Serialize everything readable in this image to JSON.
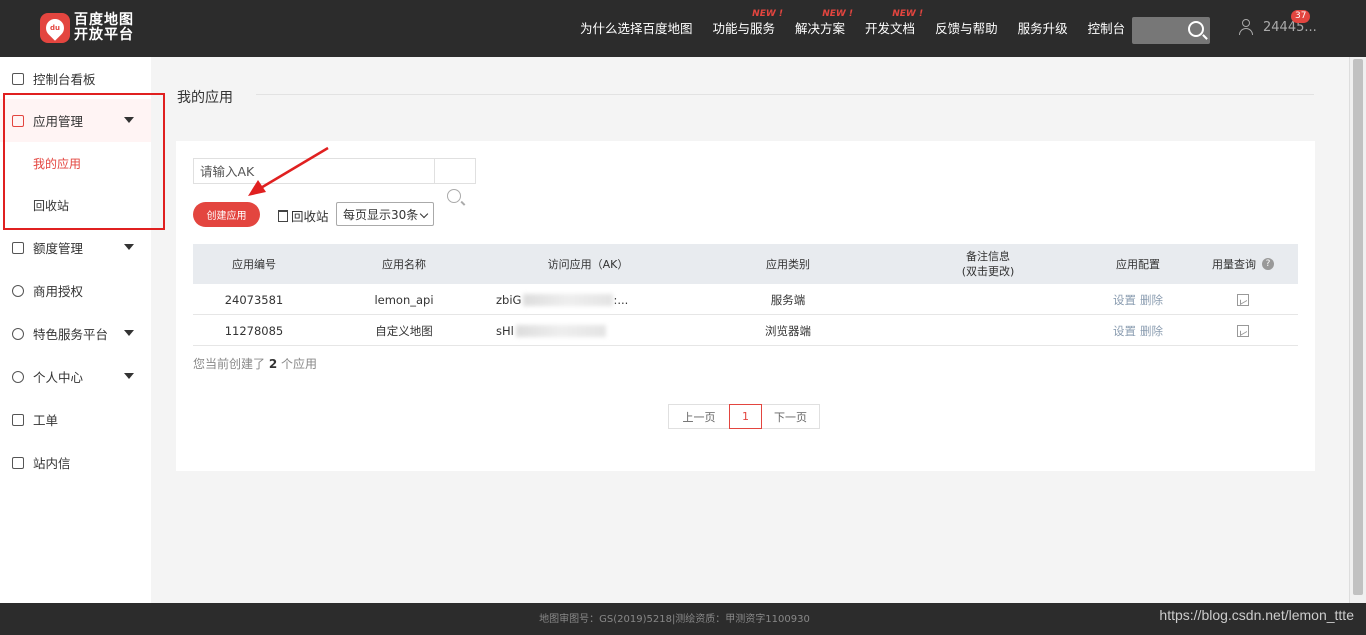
{
  "header": {
    "logo_line1": "百度地图",
    "logo_line2": "开放平台",
    "logo_badge": "du",
    "nav": [
      {
        "label": "为什么选择百度地图",
        "tag": ""
      },
      {
        "label": "功能与服务",
        "tag": "NEW !"
      },
      {
        "label": "解决方案",
        "tag": "NEW !"
      },
      {
        "label": "开发文档",
        "tag": "NEW !"
      },
      {
        "label": "反馈与帮助",
        "tag": ""
      },
      {
        "label": "服务升级",
        "tag": ""
      },
      {
        "label": "控制台",
        "tag": ""
      }
    ],
    "user_name": "24445...",
    "notification_count": "37"
  },
  "sidebar": {
    "items": [
      {
        "label": "控制台看板",
        "icon": "dashboard-icon"
      },
      {
        "label": "应用管理",
        "icon": "grid-icon"
      },
      {
        "label": "我的应用"
      },
      {
        "label": "回收站"
      },
      {
        "label": "额度管理",
        "icon": "sliders-icon"
      },
      {
        "label": "商用授权",
        "icon": "shield-icon"
      },
      {
        "label": "特色服务平台",
        "icon": "heart-shield-icon"
      },
      {
        "label": "个人中心",
        "icon": "user-circle-icon"
      },
      {
        "label": "工单",
        "icon": "clipboard-icon"
      },
      {
        "label": "站内信",
        "icon": "mail-icon"
      }
    ]
  },
  "main": {
    "title": "我的应用",
    "ak_placeholder": "请输入AK",
    "create_label": "创建应用",
    "trash_label": "回收站",
    "per_page": "每页显示30条",
    "columns": [
      "应用编号",
      "应用名称",
      "访问应用（AK）",
      "应用类别",
      "备注信息",
      "(双击更改)",
      "应用配置",
      "用量查询"
    ],
    "rows": [
      {
        "id": "24073581",
        "name": "lemon_api",
        "ak_prefix": "zbiG",
        "ak_suffix": ":...",
        "category": "服务端",
        "remark": "",
        "settings": "设置",
        "delete": "删除"
      },
      {
        "id": "11278085",
        "name": "自定义地图",
        "ak_prefix": "sHl",
        "ak_suffix": "",
        "category": "浏览器端",
        "remark": "",
        "settings": "设置",
        "delete": "删除"
      }
    ],
    "count_prefix": "您当前创建了",
    "count_value": "2",
    "count_suffix": "个应用",
    "pager": {
      "prev": "上一页",
      "current": "1",
      "next": "下一页"
    }
  },
  "footer": {
    "line1": "地图审图号：GS(2019)5218|测绘资质：甲测资字1100930",
    "watermark": "https://blog.csdn.net/lemon_ttte"
  },
  "colors": {
    "accent": "#e3453f",
    "topbar": "#2c2c2c",
    "annotation": "#e02020"
  }
}
